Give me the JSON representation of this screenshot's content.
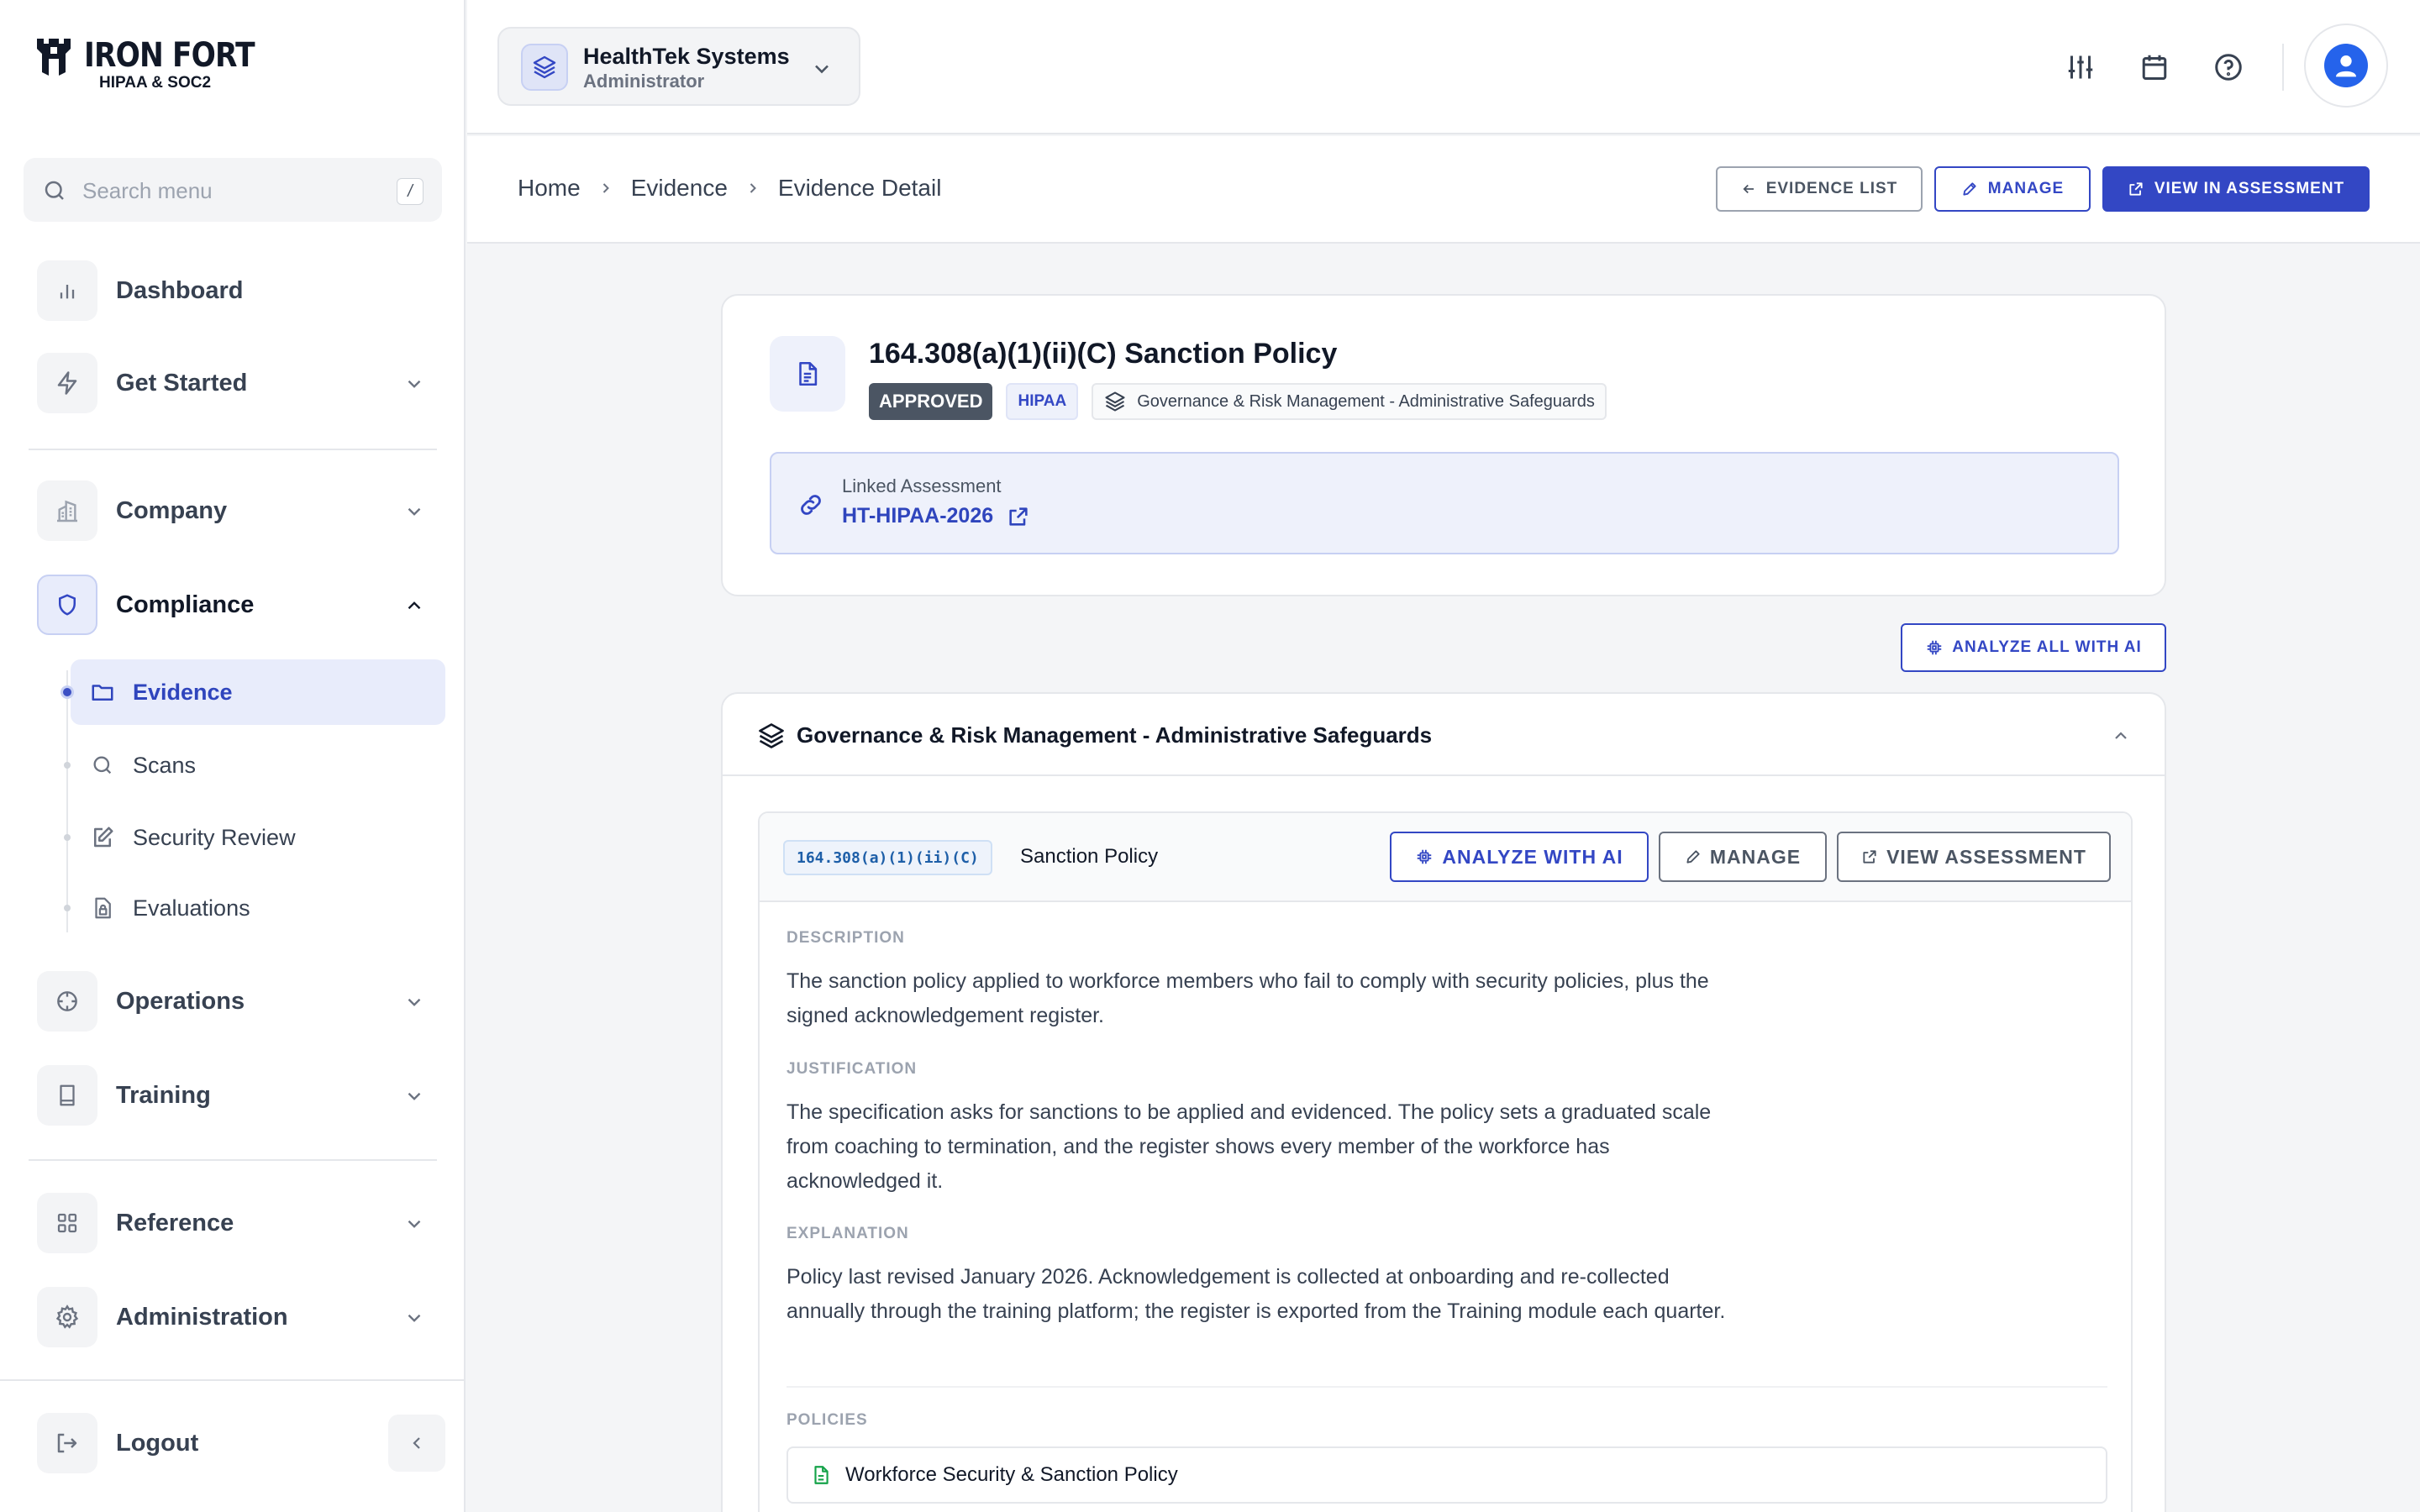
{
  "brand": {
    "name": "IRON FORT",
    "subtitle": "HIPAA & SOC2"
  },
  "search": {
    "placeholder": "Search menu",
    "shortcut": "/"
  },
  "nav": {
    "dashboard": "Dashboard",
    "get_started": "Get Started",
    "company": "Company",
    "compliance": "Compliance",
    "compliance_items": {
      "evidence": "Evidence",
      "scans": "Scans",
      "security_review": "Security Review",
      "evaluations": "Evaluations"
    },
    "operations": "Operations",
    "training": "Training",
    "reference": "Reference",
    "administration": "Administration",
    "logout": "Logout"
  },
  "org": {
    "name": "HealthTek Systems",
    "role": "Administrator"
  },
  "breadcrumb": [
    "Home",
    "Evidence",
    "Evidence Detail"
  ],
  "actions": {
    "evidence_list": "EVIDENCE LIST",
    "manage": "MANAGE",
    "view_in_assessment": "VIEW IN ASSESSMENT"
  },
  "evidence": {
    "title": "164.308(a)(1)(ii)(C) Sanction Policy",
    "status": "APPROVED",
    "framework": "HIPAA",
    "category": "Governance & Risk Management - Administrative Safeguards",
    "linked_label": "Linked Assessment",
    "linked_value": "HT-HIPAA-2026"
  },
  "analyze_all_label": "ANALYZE ALL WITH AI",
  "section": {
    "title": "Governance & Risk Management - Administrative Safeguards",
    "requirement": {
      "code": "164.308(a)(1)(ii)(C)",
      "name": "Sanction Policy",
      "analyze_label": "ANALYZE WITH AI",
      "manage_label": "MANAGE",
      "view_label": "VIEW ASSESSMENT",
      "description_label": "DESCRIPTION",
      "description": "The sanction policy applied to workforce members who fail to comply with security policies, plus the signed acknowledgement register.",
      "justification_label": "JUSTIFICATION",
      "justification": "The specification asks for sanctions to be applied and evidenced. The policy sets a graduated scale from coaching to termination, and the register shows every member of the workforce has acknowledged it.",
      "explanation_label": "EXPLANATION",
      "explanation": "Policy last revised January 2026. Acknowledgement is collected at onboarding and re-collected annually through the training platform; the register is exported from the Training module each quarter.",
      "policies_label": "POLICIES",
      "policies": [
        "Workforce Security & Sanction Policy"
      ]
    }
  },
  "colors": {
    "accent": "#3347c4",
    "status_approved": "#4b5563",
    "policy_icon": "#16a34a"
  }
}
